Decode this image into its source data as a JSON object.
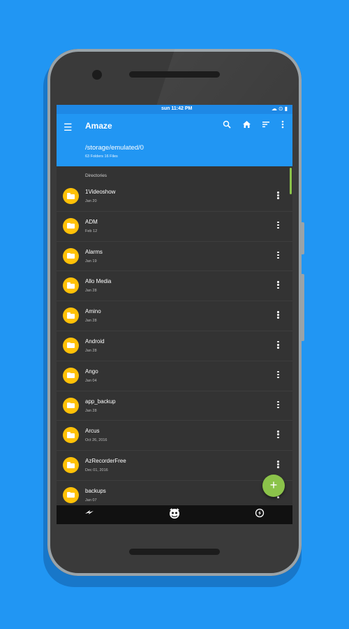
{
  "status": {
    "time": "sun 11:42 PM"
  },
  "app": {
    "title": "Amaze",
    "path": "/storage/emulated/0",
    "counts": "63 Folders 16 Files"
  },
  "section_label": "Directories",
  "toolbar_icons": [
    "search-icon",
    "home-icon",
    "sort-icon",
    "overflow-menu-icon"
  ],
  "folders": [
    {
      "name": "1Videoshow",
      "date": "Jan 20"
    },
    {
      "name": "ADM",
      "date": "Feb 12"
    },
    {
      "name": "Alarms",
      "date": "Jan 19"
    },
    {
      "name": "Allo Media",
      "date": "Jan 28"
    },
    {
      "name": "Amino",
      "date": "Jan 28"
    },
    {
      "name": "Android",
      "date": "Jan 28"
    },
    {
      "name": "Ango",
      "date": "Jan 04"
    },
    {
      "name": "app_backup",
      "date": "Jan 28"
    },
    {
      "name": "Arcus",
      "date": "Oct 26, 2016"
    },
    {
      "name": "AzRecorderFree",
      "date": "Dec 01, 2016"
    },
    {
      "name": "backups",
      "date": "Jan 07"
    }
  ],
  "fab_label": "+",
  "nav_icons": [
    "flash-icon",
    "mascot-icon",
    "no-flash-icon"
  ],
  "colors": {
    "background": "#2196F3",
    "appbar": "#2196F3",
    "statusbar": "#1E88E5",
    "folder": "#FFC107",
    "fab": "#8BC34A",
    "list_bg": "#333333"
  }
}
